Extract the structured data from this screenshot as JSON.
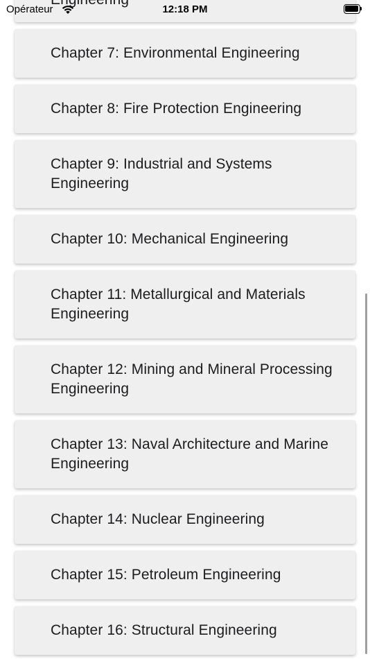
{
  "status_bar": {
    "carrier": "Opérateur",
    "time": "12:18 PM"
  },
  "partial_top_item": {
    "label": "Engineering"
  },
  "chapters": [
    {
      "label": "Chapter 7: Environmental Engineering"
    },
    {
      "label": "Chapter 8: Fire Protection Engineering"
    },
    {
      "label": "Chapter 9: Industrial and Systems Engineering"
    },
    {
      "label": "Chapter 10: Mechanical Engineering"
    },
    {
      "label": "Chapter 11: Metallurgical and Materials Engineering"
    },
    {
      "label": "Chapter 12: Mining and Mineral Processing Engineering"
    },
    {
      "label": "Chapter 13: Naval Architecture and Marine Engineering"
    },
    {
      "label": "Chapter 14: Nuclear Engineering"
    },
    {
      "label": "Chapter 15: Petroleum Engineering"
    },
    {
      "label": "Chapter 16: Structural Engineering"
    }
  ]
}
